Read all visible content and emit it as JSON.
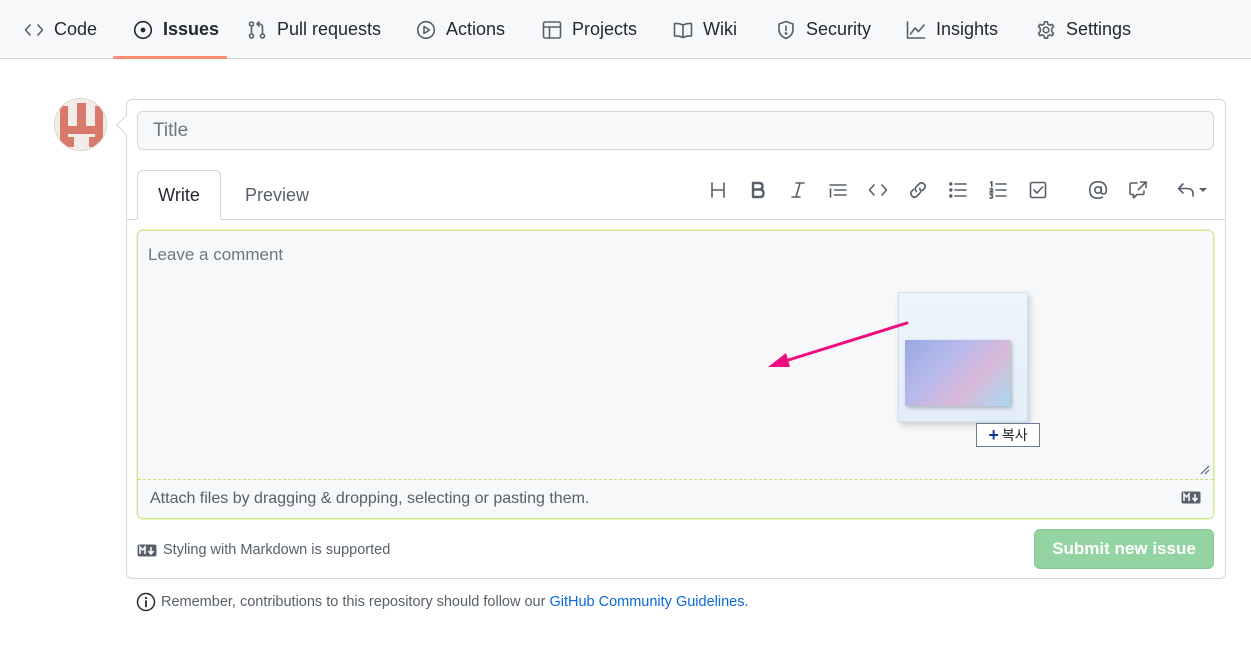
{
  "nav": {
    "items": [
      {
        "label": "Code",
        "icon": "code-icon"
      },
      {
        "label": "Issues",
        "icon": "issue-opened-icon",
        "active": true
      },
      {
        "label": "Pull requests",
        "icon": "git-pull-request-icon"
      },
      {
        "label": "Actions",
        "icon": "play-icon"
      },
      {
        "label": "Projects",
        "icon": "table-icon"
      },
      {
        "label": "Wiki",
        "icon": "book-icon"
      },
      {
        "label": "Security",
        "icon": "shield-icon"
      },
      {
        "label": "Insights",
        "icon": "graph-icon"
      },
      {
        "label": "Settings",
        "icon": "gear-icon"
      }
    ]
  },
  "form": {
    "title_placeholder": "Title",
    "tabs": {
      "write": "Write",
      "preview": "Preview"
    },
    "toolbar": [
      "heading",
      "bold",
      "italic",
      "quote",
      "code",
      "link",
      "bulleted-list",
      "numbered-list",
      "task-list",
      "mention",
      "reference",
      "undo"
    ],
    "comment_placeholder": "Leave a comment",
    "attach_text": "Attach files by dragging & dropping, selecting or pasting them.",
    "markdown_hint": "Styling with Markdown is supported",
    "submit_label": "Submit new issue"
  },
  "drag_overlay": {
    "copy_label": "복사"
  },
  "footer": {
    "note_prefix": "Remember, contributions to this repository should follow our",
    "link_text": "GitHub Community Guidelines",
    "note_suffix": "."
  },
  "colors": {
    "accent_underline": "#fd8c73",
    "submit_disabled": "#94d3a2",
    "link": "#0969da",
    "drag_arrow": "#ee0c7f"
  }
}
